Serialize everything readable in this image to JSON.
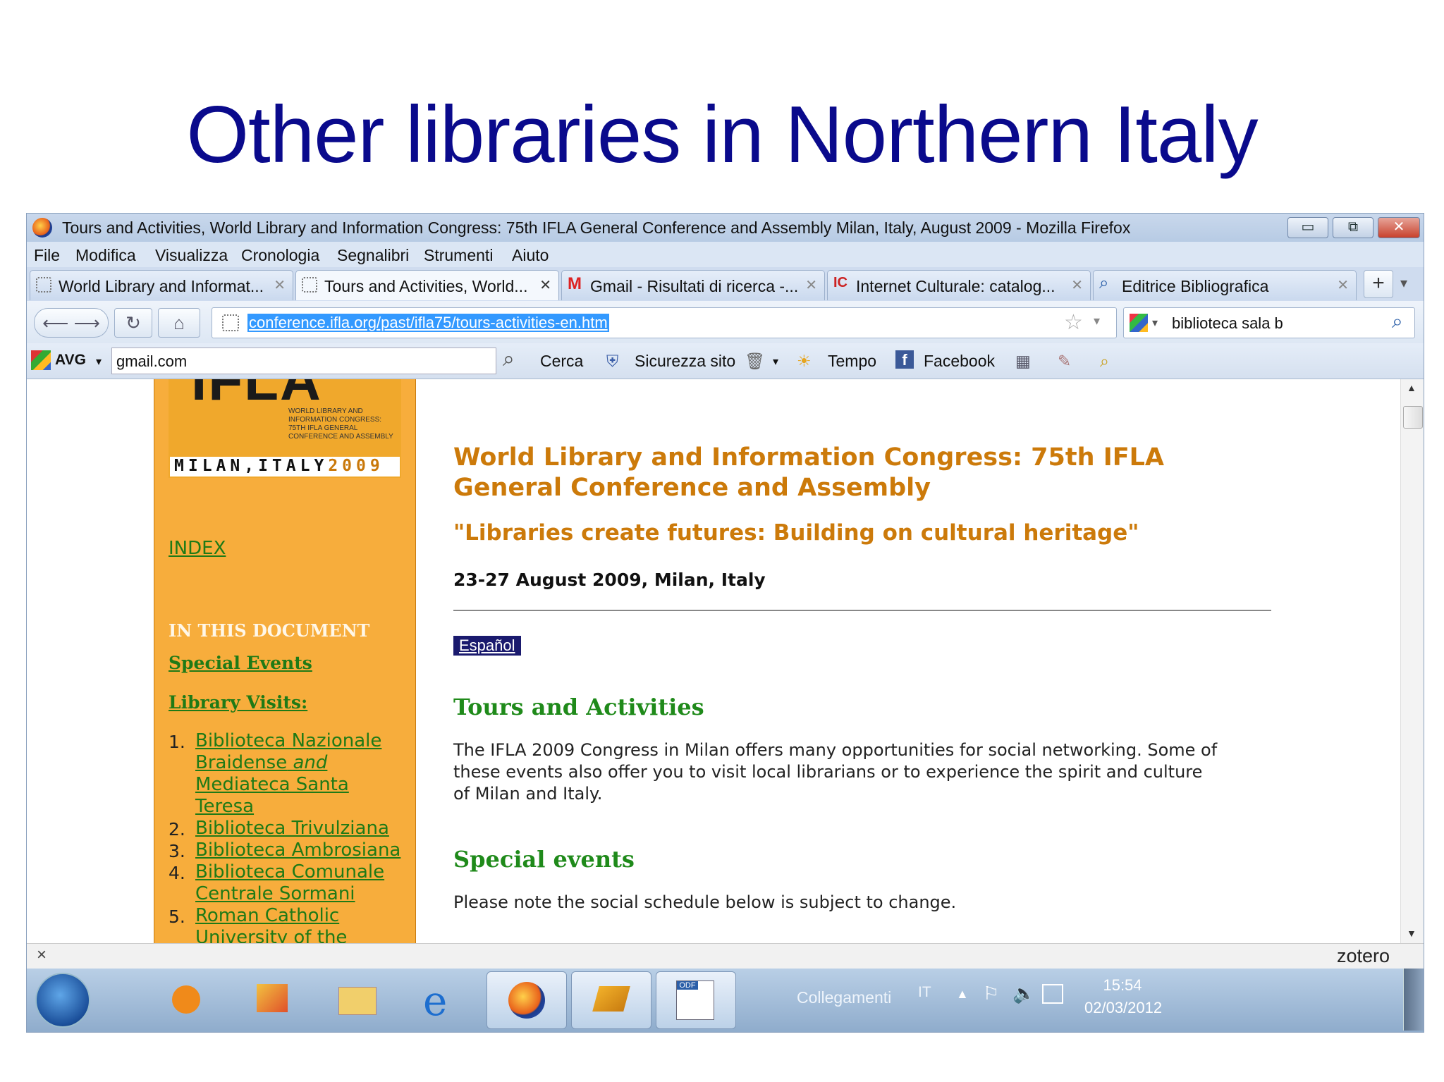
{
  "slide": {
    "title": "Other libraries in Northern Italy"
  },
  "window": {
    "title": "Tours and Activities, World Library and Information Congress: 75th IFLA General Conference and Assembly Milan, Italy, August 2009 - Mozilla Firefox",
    "controls": {
      "minimize": "▭",
      "restore": "⧉",
      "close": "✕"
    }
  },
  "menu": [
    "File",
    "Modifica",
    "Visualizza",
    "Cronologia",
    "Segnalibri",
    "Strumenti",
    "Aiuto"
  ],
  "tabs": [
    {
      "label": "World Library and Informat...",
      "icon": "page-icon"
    },
    {
      "label": "Tours and Activities, World...",
      "icon": "page-icon",
      "active": true
    },
    {
      "label": "Gmail - Risultati di ricerca -...",
      "icon": "gmail-icon"
    },
    {
      "label": "Internet Culturale: catalog...",
      "icon": "ic-icon"
    },
    {
      "label": "Editrice Bibliografica",
      "icon": "search-icon"
    }
  ],
  "tab_controls": {
    "new_tab": "+",
    "list": "▾"
  },
  "navigation": {
    "url": "conference.ifla.org/past/ifla75/tours-activities-en.htm",
    "search_value": "biblioteca sala b"
  },
  "avg_toolbar": {
    "brand": "AVG",
    "search_value": "gmail.com",
    "search_label": "Cerca",
    "security_label": "Sicurezza sito",
    "weather_label": "Tempo",
    "facebook_label": "Facebook"
  },
  "page": {
    "logo": {
      "line1": "WORLD LIBRARY AND",
      "line2": "INFORMATION CONGRESS:",
      "line3": "75TH IFLA GENERAL",
      "line4": "CONFERENCE AND ASSEMBLY",
      "location": "MILAN,ITALY",
      "year": "2009",
      "brand": "IFLA"
    },
    "sidebar": {
      "index_link": "INDEX",
      "section_heading": "IN THIS DOCUMENT",
      "special_events": "Special Events",
      "library_visits": "Library Visits:",
      "visits": [
        {
          "num": "1.",
          "lines": [
            "Biblioteca Nazionale",
            "Braidense",
            "and",
            "Mediateca Santa",
            "Teresa"
          ]
        },
        {
          "num": "2.",
          "lines": [
            "Biblioteca Trivulziana"
          ]
        },
        {
          "num": "3.",
          "lines": [
            "Biblioteca Ambrosiana"
          ]
        },
        {
          "num": "4.",
          "lines": [
            "Biblioteca Comunale",
            "Centrale Sormani"
          ]
        },
        {
          "num": "5.",
          "lines": [
            "Roman Catholic",
            "University of the"
          ]
        }
      ]
    },
    "main": {
      "heading_line1": "World Library and Information Congress: 75th IFLA",
      "heading_line2": "General Conference and Assembly",
      "theme": "\"Libraries create futures: Building on cultural heritage\"",
      "dates": "23-27 August 2009, Milan, Italy",
      "language_link": "Español",
      "tours_heading": "Tours and Activities",
      "intro_line1": "The IFLA 2009 Congress in Milan offers many opportunities for social networking. Some of",
      "intro_line2": "these events also offer you to visit local librarians or to experience the spirit and culture",
      "intro_line3": "of Milan and Italy.",
      "special_events_heading": "Special events",
      "note": "Please note the social schedule below is subject to change."
    }
  },
  "statusbar": {
    "close": "×",
    "zotero": "zotero"
  },
  "taskbar": {
    "links_label": "Collegamenti",
    "lang": "IT",
    "time": "15:54",
    "date": "02/03/2012"
  },
  "colors": {
    "title_blue": "#0a0a8c",
    "sidebar_orange": "#f7ad3c",
    "heading_orange": "#cc7a0a",
    "heading_green": "#1f8a1a",
    "url_highlight": "#3399ff"
  }
}
